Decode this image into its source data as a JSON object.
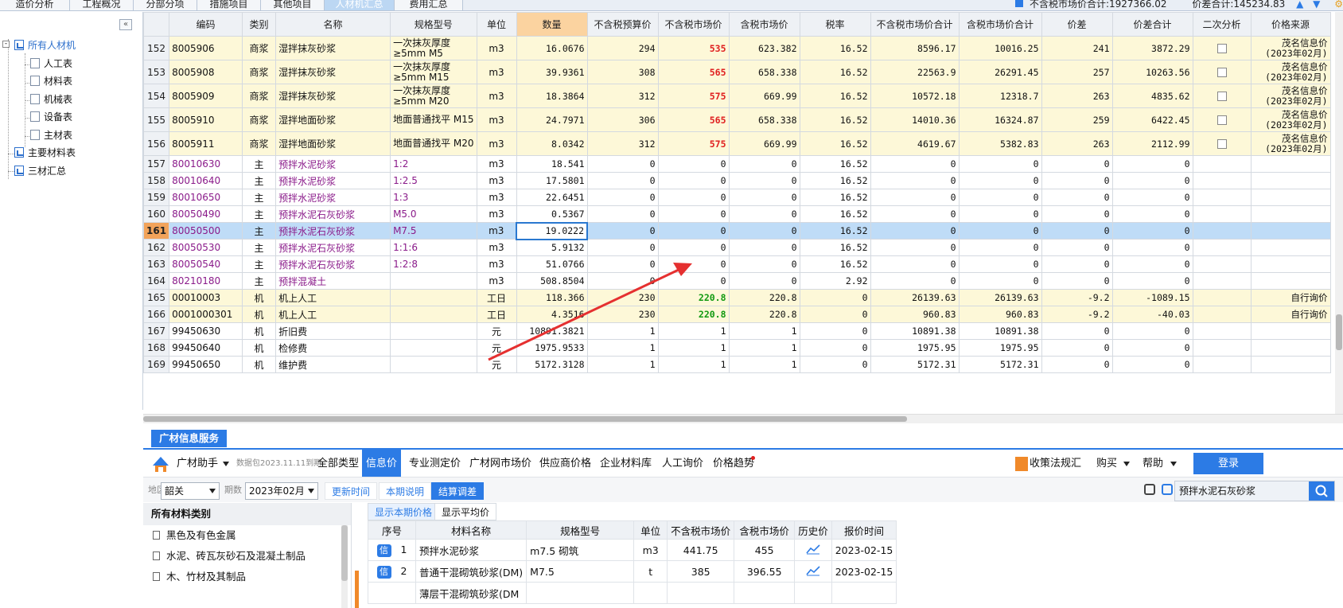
{
  "tabs": [
    {
      "label": "造价分析",
      "active": false
    },
    {
      "label": "工程概况",
      "active": false
    },
    {
      "label": "分部分项",
      "active": false
    },
    {
      "label": "措施项目",
      "active": false
    },
    {
      "label": "其他项目",
      "active": false
    },
    {
      "label": "人材机汇总",
      "active": true
    },
    {
      "label": "费用汇总",
      "active": false
    }
  ],
  "summary": {
    "text1": "不含税市场价合计:1927366.02",
    "text2": "价差合计:145234.83"
  },
  "tree": {
    "root": "所有人材机",
    "children": [
      "人工表",
      "材料表",
      "机械表",
      "设备表",
      "主材表"
    ],
    "extra": [
      "主要材料表",
      "三材汇总"
    ]
  },
  "grid": {
    "headers": [
      "",
      "编码",
      "类别",
      "名称",
      "规格型号",
      "单位",
      "数量",
      "不含税预算价",
      "不含税市场价",
      "含税市场价",
      "税率",
      "不含税市场价合计",
      "含税市场价合计",
      "价差",
      "价差合计",
      "二次分析",
      "价格来源"
    ],
    "rows": [
      {
        "no": "152",
        "code": "8005906",
        "cat": "商浆",
        "name": "湿拌抹灰砂浆",
        "spec": "一次抹灰厚度\n≥5mm M5",
        "unit": "m3",
        "qty": "16.0676",
        "budget": "294",
        "market": "535",
        "taxed": "623.382",
        "rate": "16.52",
        "sum": "8596.17",
        "taxsum": "10016.25",
        "diff": "241",
        "diffsum": "3872.29",
        "check": true,
        "src": "茂名信息价\n(2023年02月)",
        "style": "cheng",
        "mkhot": "red"
      },
      {
        "no": "153",
        "code": "8005908",
        "cat": "商浆",
        "name": "湿拌抹灰砂浆",
        "spec": "一次抹灰厚度\n≥5mm M15",
        "unit": "m3",
        "qty": "39.9361",
        "budget": "308",
        "market": "565",
        "taxed": "658.338",
        "rate": "16.52",
        "sum": "22563.9",
        "taxsum": "26291.45",
        "diff": "257",
        "diffsum": "10263.56",
        "check": true,
        "src": "茂名信息价\n(2023年02月)",
        "style": "cheng",
        "mkhot": "red"
      },
      {
        "no": "154",
        "code": "8005909",
        "cat": "商浆",
        "name": "湿拌抹灰砂浆",
        "spec": "一次抹灰厚度\n≥5mm M20",
        "unit": "m3",
        "qty": "18.3864",
        "budget": "312",
        "market": "575",
        "taxed": "669.99",
        "rate": "16.52",
        "sum": "10572.18",
        "taxsum": "12318.7",
        "diff": "263",
        "diffsum": "4835.62",
        "check": true,
        "src": "茂名信息价\n(2023年02月)",
        "style": "cheng",
        "mkhot": "red"
      },
      {
        "no": "155",
        "code": "8005910",
        "cat": "商浆",
        "name": "湿拌地面砂浆",
        "spec": "地面普通找平 M15",
        "unit": "m3",
        "qty": "24.7971",
        "budget": "306",
        "market": "565",
        "taxed": "658.338",
        "rate": "16.52",
        "sum": "14010.36",
        "taxsum": "16324.87",
        "diff": "259",
        "diffsum": "6422.45",
        "check": true,
        "src": "茂名信息价\n(2023年02月)",
        "style": "cheng",
        "mkhot": "red"
      },
      {
        "no": "156",
        "code": "8005911",
        "cat": "商浆",
        "name": "湿拌地面砂浆",
        "spec": "地面普通找平 M20",
        "unit": "m3",
        "qty": "8.0342",
        "budget": "312",
        "market": "575",
        "taxed": "669.99",
        "rate": "16.52",
        "sum": "4619.67",
        "taxsum": "5382.83",
        "diff": "263",
        "diffsum": "2112.99",
        "check": true,
        "src": "茂名信息价\n(2023年02月)",
        "style": "cheng",
        "mkhot": "red"
      },
      {
        "no": "157",
        "code": "80010630",
        "cat": "主",
        "name": "预拌水泥砂浆",
        "spec": "1:2",
        "unit": "m3",
        "qty": "18.541",
        "budget": "0",
        "market": "0",
        "taxed": "0",
        "rate": "16.52",
        "sum": "0",
        "taxsum": "0",
        "diff": "0",
        "diffsum": "0",
        "check": false,
        "src": "",
        "style": "zhu",
        "mkhot": ""
      },
      {
        "no": "158",
        "code": "80010640",
        "cat": "主",
        "name": "预拌水泥砂浆",
        "spec": "1:2.5",
        "unit": "m3",
        "qty": "17.5801",
        "budget": "0",
        "market": "0",
        "taxed": "0",
        "rate": "16.52",
        "sum": "0",
        "taxsum": "0",
        "diff": "0",
        "diffsum": "0",
        "check": false,
        "src": "",
        "style": "zhu",
        "mkhot": ""
      },
      {
        "no": "159",
        "code": "80010650",
        "cat": "主",
        "name": "预拌水泥砂浆",
        "spec": "1:3",
        "unit": "m3",
        "qty": "22.6451",
        "budget": "0",
        "market": "0",
        "taxed": "0",
        "rate": "16.52",
        "sum": "0",
        "taxsum": "0",
        "diff": "0",
        "diffsum": "0",
        "check": false,
        "src": "",
        "style": "zhu",
        "mkhot": ""
      },
      {
        "no": "160",
        "code": "80050490",
        "cat": "主",
        "name": "预拌水泥石灰砂浆",
        "spec": "M5.0",
        "unit": "m3",
        "qty": "0.5367",
        "budget": "0",
        "market": "0",
        "taxed": "0",
        "rate": "16.52",
        "sum": "0",
        "taxsum": "0",
        "diff": "0",
        "diffsum": "0",
        "check": false,
        "src": "",
        "style": "zhu",
        "mkhot": ""
      },
      {
        "no": "161",
        "code": "80050500",
        "cat": "主",
        "name": "预拌水泥石灰砂浆",
        "spec": "M7.5",
        "unit": "m3",
        "qty": "19.0222",
        "budget": "0",
        "market": "0",
        "taxed": "0",
        "rate": "16.52",
        "sum": "0",
        "taxsum": "0",
        "diff": "0",
        "diffsum": "0",
        "check": false,
        "src": "",
        "style": "zhu sel",
        "mkhot": ""
      },
      {
        "no": "162",
        "code": "80050530",
        "cat": "主",
        "name": "预拌水泥石灰砂浆",
        "spec": "1:1:6",
        "unit": "m3",
        "qty": "5.9132",
        "budget": "0",
        "market": "0",
        "taxed": "0",
        "rate": "16.52",
        "sum": "0",
        "taxsum": "0",
        "diff": "0",
        "diffsum": "0",
        "check": false,
        "src": "",
        "style": "zhu",
        "mkhot": ""
      },
      {
        "no": "163",
        "code": "80050540",
        "cat": "主",
        "name": "预拌水泥石灰砂浆",
        "spec": "1:2:8",
        "unit": "m3",
        "qty": "51.0766",
        "budget": "0",
        "market": "0",
        "taxed": "0",
        "rate": "16.52",
        "sum": "0",
        "taxsum": "0",
        "diff": "0",
        "diffsum": "0",
        "check": false,
        "src": "",
        "style": "zhu",
        "mkhot": ""
      },
      {
        "no": "164",
        "code": "80210180",
        "cat": "主",
        "name": "预拌混凝土",
        "spec": "",
        "unit": "m3",
        "qty": "508.8504",
        "budget": "0",
        "market": "0",
        "taxed": "0",
        "rate": "2.92",
        "sum": "0",
        "taxsum": "0",
        "diff": "0",
        "diffsum": "0",
        "check": false,
        "src": "",
        "style": "zhu",
        "mkhot": ""
      },
      {
        "no": "165",
        "code": "00010003",
        "cat": "机",
        "name": "机上人工",
        "spec": "",
        "unit": "工日",
        "qty": "118.366",
        "budget": "230",
        "market": "220.8",
        "taxed": "220.8",
        "rate": "0",
        "sum": "26139.63",
        "taxsum": "26139.63",
        "diff": "-9.2",
        "diffsum": "-1089.15",
        "check": false,
        "src": "自行询价",
        "style": "cheng",
        "mkhot": "green"
      },
      {
        "no": "166",
        "code": "0001000301",
        "cat": "机",
        "name": "机上人工",
        "spec": "",
        "unit": "工日",
        "qty": "4.3516",
        "budget": "230",
        "market": "220.8",
        "taxed": "220.8",
        "rate": "0",
        "sum": "960.83",
        "taxsum": "960.83",
        "diff": "-9.2",
        "diffsum": "-40.03",
        "check": false,
        "src": "自行询价",
        "style": "cheng",
        "mkhot": "green"
      },
      {
        "no": "167",
        "code": "99450630",
        "cat": "机",
        "name": "折旧费",
        "spec": "",
        "unit": "元",
        "qty": "10891.3821",
        "budget": "1",
        "market": "1",
        "taxed": "1",
        "rate": "0",
        "sum": "10891.38",
        "taxsum": "10891.38",
        "diff": "0",
        "diffsum": "0",
        "check": false,
        "src": "",
        "style": "",
        "mkhot": ""
      },
      {
        "no": "168",
        "code": "99450640",
        "cat": "机",
        "name": "检修费",
        "spec": "",
        "unit": "元",
        "qty": "1975.9533",
        "budget": "1",
        "market": "1",
        "taxed": "1",
        "rate": "0",
        "sum": "1975.95",
        "taxsum": "1975.95",
        "diff": "0",
        "diffsum": "0",
        "check": false,
        "src": "",
        "style": "",
        "mkhot": ""
      },
      {
        "no": "169",
        "code": "99450650",
        "cat": "机",
        "name": "维护费",
        "spec": "",
        "unit": "元",
        "qty": "5172.3128",
        "budget": "1",
        "market": "1",
        "taxed": "1",
        "rate": "0",
        "sum": "5172.31",
        "taxsum": "5172.31",
        "diff": "0",
        "diffsum": "0",
        "check": false,
        "src": "",
        "style": "",
        "mkhot": ""
      }
    ]
  },
  "bottom": {
    "service_tab": "广材信息服务",
    "brand": "广材助手",
    "package": "数据包2023.11.11到期",
    "nav": [
      "全部类型",
      "信息价",
      "专业测定价",
      "广材网市场价",
      "供应商价格",
      "企业材料库",
      "人工询价",
      "价格趋势"
    ],
    "nav_active": "信息价",
    "right_nav": [
      "收策法规汇",
      "购买",
      "帮助",
      "登录"
    ],
    "region_label": "地区",
    "region": "韶关",
    "period_label": "期数",
    "period": "2023年02月",
    "buttons": [
      "更新时间",
      "本期说明",
      "结算调差"
    ],
    "search": "预拌水泥石灰砂浆",
    "category_header": "所有材料类别",
    "categories": [
      "黑色及有色金属",
      "水泥、砖瓦灰砂石及混凝土制品",
      "木、竹材及其制品"
    ],
    "price_tabs": [
      "显示本期价格",
      "显示平均价"
    ],
    "price_headers": [
      "序号",
      "材料名称",
      "规格型号",
      "单位",
      "不含税市场价",
      "含税市场价",
      "历史价",
      "报价时间"
    ],
    "price_rows": [
      {
        "tag": "信",
        "no": "1",
        "name": "预拌水泥砂浆",
        "spec": "m7.5 砌筑",
        "unit": "m3",
        "pre": "441.75",
        "tax": "455",
        "date": "2023-02-15"
      },
      {
        "tag": "信",
        "no": "2",
        "name": "普通干混砌筑砂浆(DM)",
        "spec": "M7.5",
        "unit": "t",
        "pre": "385",
        "tax": "396.55",
        "date": "2023-02-15"
      },
      {
        "tag": "",
        "no": "",
        "name": "薄层干混砌筑砂浆(DM",
        "spec": "",
        "unit": "",
        "pre": "",
        "tax": "",
        "date": ""
      }
    ]
  },
  "colors": {
    "accent": "#2c7be5",
    "hot": "#e02020",
    "green": "#119a11",
    "annotation": "#e53030"
  }
}
